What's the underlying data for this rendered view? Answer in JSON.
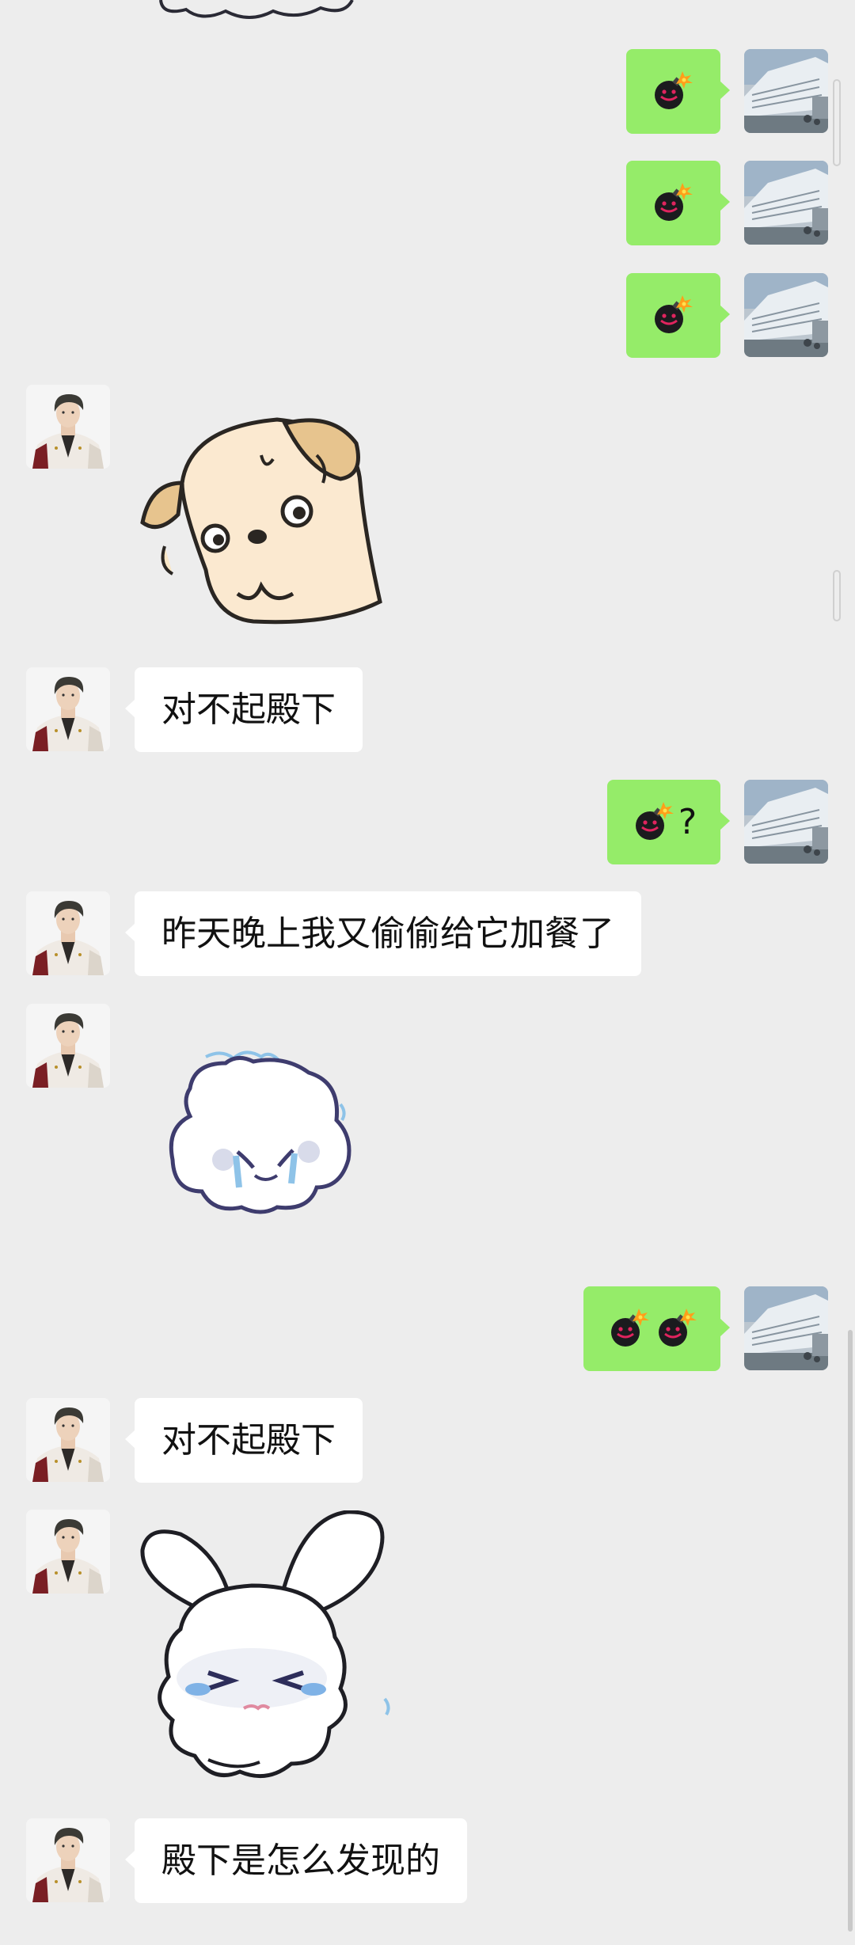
{
  "messages": [
    {
      "from": "me",
      "emoji": "bomb",
      "text": ""
    },
    {
      "from": "me",
      "emoji": "bomb",
      "text": ""
    },
    {
      "from": "me",
      "emoji": "bomb",
      "text": ""
    },
    {
      "from": "them",
      "sticker": "shy-puppy-sticker"
    },
    {
      "from": "them",
      "text": "对不起殿下"
    },
    {
      "from": "me",
      "emoji": "bomb",
      "text": "?"
    },
    {
      "from": "them",
      "text": "昨天晚上我又偷偷给它加餐了"
    },
    {
      "from": "them",
      "sticker": "crying-bear-sticker"
    },
    {
      "from": "me",
      "emoji": "bomb",
      "emoji_count": 2
    },
    {
      "from": "them",
      "text": "对不起殿下"
    },
    {
      "from": "them",
      "sticker": "crying-bunny-sticker"
    },
    {
      "from": "them",
      "text": "殿下是怎么发现的"
    }
  ],
  "colors": {
    "background": "#ededed",
    "outgoing_bubble": "#95ec69",
    "incoming_bubble": "#ffffff"
  },
  "icons": {
    "my_avatar": "ship-photo-avatar",
    "their_avatar": "man-in-white-uniform-avatar",
    "emoji": "bomb-emoji"
  }
}
